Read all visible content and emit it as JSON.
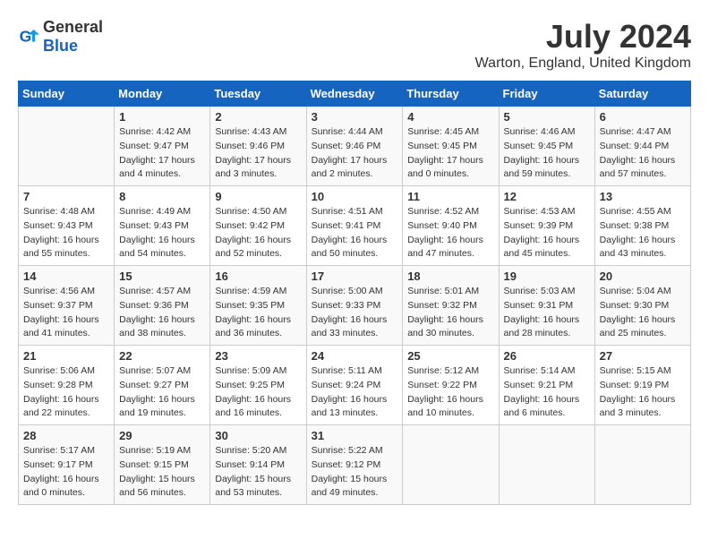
{
  "header": {
    "logo_general": "General",
    "logo_blue": "Blue",
    "month_year": "July 2024",
    "location": "Warton, England, United Kingdom"
  },
  "calendar": {
    "days_of_week": [
      "Sunday",
      "Monday",
      "Tuesday",
      "Wednesday",
      "Thursday",
      "Friday",
      "Saturday"
    ],
    "weeks": [
      [
        {
          "day": "",
          "info": ""
        },
        {
          "day": "1",
          "info": "Sunrise: 4:42 AM\nSunset: 9:47 PM\nDaylight: 17 hours\nand 4 minutes."
        },
        {
          "day": "2",
          "info": "Sunrise: 4:43 AM\nSunset: 9:46 PM\nDaylight: 17 hours\nand 3 minutes."
        },
        {
          "day": "3",
          "info": "Sunrise: 4:44 AM\nSunset: 9:46 PM\nDaylight: 17 hours\nand 2 minutes."
        },
        {
          "day": "4",
          "info": "Sunrise: 4:45 AM\nSunset: 9:45 PM\nDaylight: 17 hours\nand 0 minutes."
        },
        {
          "day": "5",
          "info": "Sunrise: 4:46 AM\nSunset: 9:45 PM\nDaylight: 16 hours\nand 59 minutes."
        },
        {
          "day": "6",
          "info": "Sunrise: 4:47 AM\nSunset: 9:44 PM\nDaylight: 16 hours\nand 57 minutes."
        }
      ],
      [
        {
          "day": "7",
          "info": "Sunrise: 4:48 AM\nSunset: 9:43 PM\nDaylight: 16 hours\nand 55 minutes."
        },
        {
          "day": "8",
          "info": "Sunrise: 4:49 AM\nSunset: 9:43 PM\nDaylight: 16 hours\nand 54 minutes."
        },
        {
          "day": "9",
          "info": "Sunrise: 4:50 AM\nSunset: 9:42 PM\nDaylight: 16 hours\nand 52 minutes."
        },
        {
          "day": "10",
          "info": "Sunrise: 4:51 AM\nSunset: 9:41 PM\nDaylight: 16 hours\nand 50 minutes."
        },
        {
          "day": "11",
          "info": "Sunrise: 4:52 AM\nSunset: 9:40 PM\nDaylight: 16 hours\nand 47 minutes."
        },
        {
          "day": "12",
          "info": "Sunrise: 4:53 AM\nSunset: 9:39 PM\nDaylight: 16 hours\nand 45 minutes."
        },
        {
          "day": "13",
          "info": "Sunrise: 4:55 AM\nSunset: 9:38 PM\nDaylight: 16 hours\nand 43 minutes."
        }
      ],
      [
        {
          "day": "14",
          "info": "Sunrise: 4:56 AM\nSunset: 9:37 PM\nDaylight: 16 hours\nand 41 minutes."
        },
        {
          "day": "15",
          "info": "Sunrise: 4:57 AM\nSunset: 9:36 PM\nDaylight: 16 hours\nand 38 minutes."
        },
        {
          "day": "16",
          "info": "Sunrise: 4:59 AM\nSunset: 9:35 PM\nDaylight: 16 hours\nand 36 minutes."
        },
        {
          "day": "17",
          "info": "Sunrise: 5:00 AM\nSunset: 9:33 PM\nDaylight: 16 hours\nand 33 minutes."
        },
        {
          "day": "18",
          "info": "Sunrise: 5:01 AM\nSunset: 9:32 PM\nDaylight: 16 hours\nand 30 minutes."
        },
        {
          "day": "19",
          "info": "Sunrise: 5:03 AM\nSunset: 9:31 PM\nDaylight: 16 hours\nand 28 minutes."
        },
        {
          "day": "20",
          "info": "Sunrise: 5:04 AM\nSunset: 9:30 PM\nDaylight: 16 hours\nand 25 minutes."
        }
      ],
      [
        {
          "day": "21",
          "info": "Sunrise: 5:06 AM\nSunset: 9:28 PM\nDaylight: 16 hours\nand 22 minutes."
        },
        {
          "day": "22",
          "info": "Sunrise: 5:07 AM\nSunset: 9:27 PM\nDaylight: 16 hours\nand 19 minutes."
        },
        {
          "day": "23",
          "info": "Sunrise: 5:09 AM\nSunset: 9:25 PM\nDaylight: 16 hours\nand 16 minutes."
        },
        {
          "day": "24",
          "info": "Sunrise: 5:11 AM\nSunset: 9:24 PM\nDaylight: 16 hours\nand 13 minutes."
        },
        {
          "day": "25",
          "info": "Sunrise: 5:12 AM\nSunset: 9:22 PM\nDaylight: 16 hours\nand 10 minutes."
        },
        {
          "day": "26",
          "info": "Sunrise: 5:14 AM\nSunset: 9:21 PM\nDaylight: 16 hours\nand 6 minutes."
        },
        {
          "day": "27",
          "info": "Sunrise: 5:15 AM\nSunset: 9:19 PM\nDaylight: 16 hours\nand 3 minutes."
        }
      ],
      [
        {
          "day": "28",
          "info": "Sunrise: 5:17 AM\nSunset: 9:17 PM\nDaylight: 16 hours\nand 0 minutes."
        },
        {
          "day": "29",
          "info": "Sunrise: 5:19 AM\nSunset: 9:15 PM\nDaylight: 15 hours\nand 56 minutes."
        },
        {
          "day": "30",
          "info": "Sunrise: 5:20 AM\nSunset: 9:14 PM\nDaylight: 15 hours\nand 53 minutes."
        },
        {
          "day": "31",
          "info": "Sunrise: 5:22 AM\nSunset: 9:12 PM\nDaylight: 15 hours\nand 49 minutes."
        },
        {
          "day": "",
          "info": ""
        },
        {
          "day": "",
          "info": ""
        },
        {
          "day": "",
          "info": ""
        }
      ]
    ]
  }
}
